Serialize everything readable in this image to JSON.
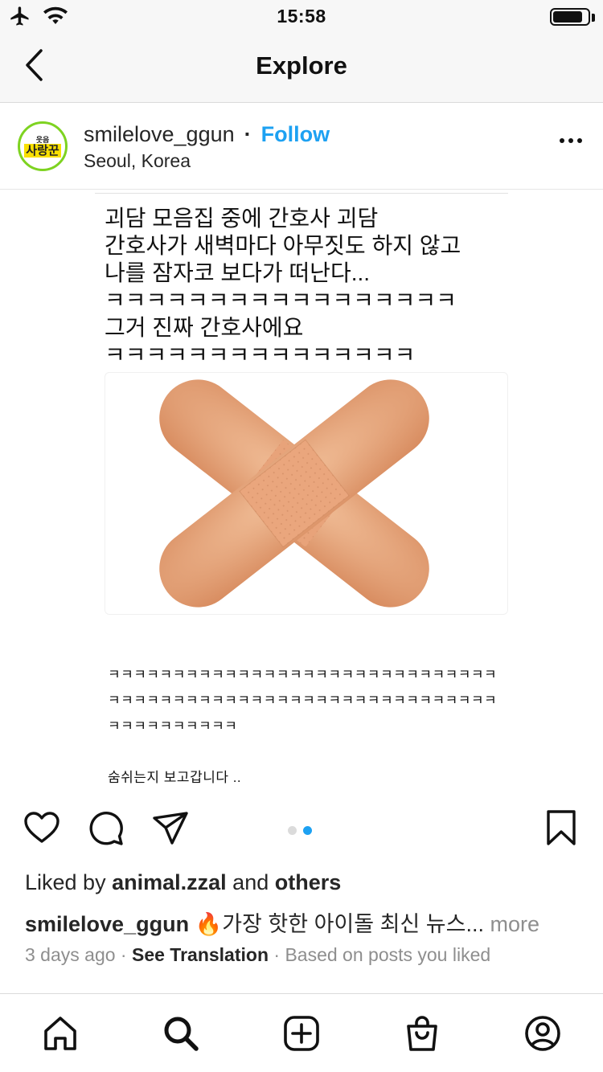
{
  "status_bar": {
    "time": "15:58",
    "icons": [
      "airplane-icon",
      "wifi-icon",
      "battery-icon"
    ],
    "battery_level": 0.85
  },
  "nav": {
    "title": "Explore",
    "back_icon": "chevron-left-icon"
  },
  "post": {
    "avatar_text_small": "웃음",
    "avatar_text_big": "사랑꾼",
    "username": "smilelove_ggun",
    "separator": "·",
    "follow_label": "Follow",
    "location": "Seoul, Korea",
    "more_icon": "more-horizontal-icon"
  },
  "media": {
    "meme_lines": [
      "괴담 모음집 중에 간호사 괴담",
      "간호사가 새벽마다 아무짓도 하지 않고",
      "나를 잠자코 보다가 떠난다...",
      "ㅋㅋㅋㅋㅋㅋㅋㅋㅋㅋㅋㅋㅋㅋㅋㅋㅋ",
      "그거 진짜 간호사에요",
      "ㅋㅋㅋㅋㅋㅋㅋㅋㅋㅋㅋㅋㅋㅋㅋ"
    ],
    "image_subject": "crossed-bandages",
    "caption_lines": [
      "ㅋㅋㅋㅋㅋㅋㅋㅋㅋㅋㅋㅋㅋㅋㅋㅋㅋㅋㅋㅋㅋㅋㅋㅋㅋㅋㅋㅋㅋㅋ",
      "ㅋㅋㅋㅋㅋㅋㅋㅋㅋㅋㅋㅋㅋㅋㅋㅋㅋㅋㅋㅋㅋㅋㅋㅋㅋㅋㅋㅋㅋㅋ",
      "ㅋㅋㅋㅋㅋㅋㅋㅋㅋㅋ"
    ],
    "footer_line": "숨쉬는지 보고갑니다 ..",
    "carousel": {
      "count": 2,
      "active_index": 1,
      "active_color": "#1da1f2",
      "inactive_color": "#dbdbdb"
    }
  },
  "actions": {
    "icons": [
      "heart-icon",
      "comment-icon",
      "share-icon",
      "bookmark-icon"
    ]
  },
  "likes": {
    "prefix": "Liked by",
    "user": "animal.zzal",
    "conjunction": "and",
    "others": "others"
  },
  "caption": {
    "username": "smilelove_ggun",
    "emoji": "🔥",
    "text": "가장 핫한 아이돌 최신 뉴스...",
    "more_label": "more"
  },
  "meta": {
    "time": "3 days ago",
    "dot": "·",
    "translation_label": "See Translation",
    "reason": "Based on posts you liked"
  },
  "tab_bar": {
    "items": [
      "home-icon",
      "search-icon",
      "new-post-icon",
      "shop-icon",
      "profile-icon"
    ],
    "active": "search-icon"
  },
  "colors": {
    "follow": "#1da1f2",
    "muted": "#8e8e8e",
    "text": "#262626",
    "divider": "#dbdbdb"
  }
}
